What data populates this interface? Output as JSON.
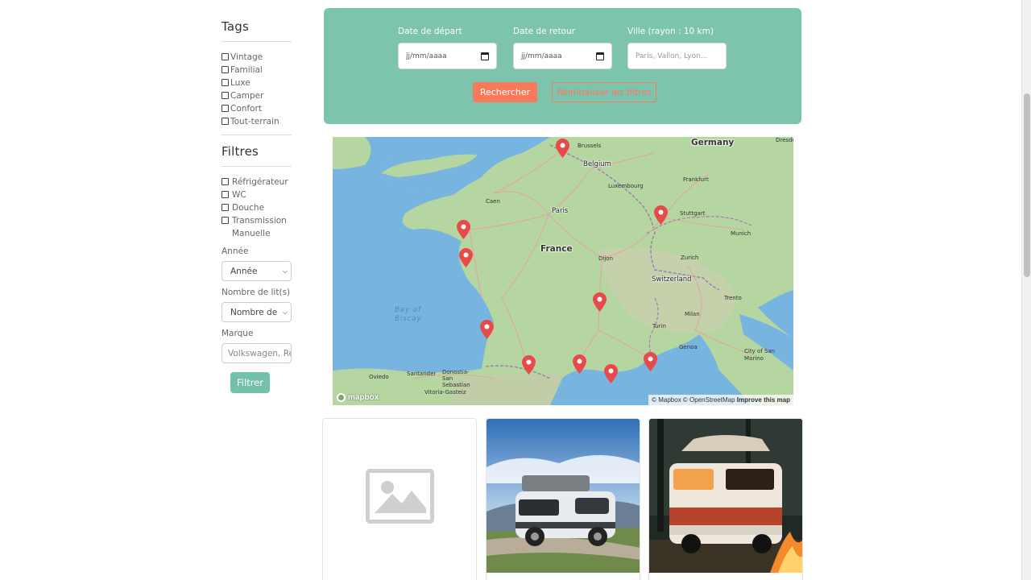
{
  "sidebar": {
    "tags_title": "Tags",
    "tags": [
      "Vintage",
      "Familial",
      "Luxe",
      "Camper",
      "Confort",
      "Tout-terrain"
    ],
    "filters_title": "Filtres",
    "filters": [
      "Réfrigérateur",
      "WC",
      "Douche",
      "Transmission Manuelle"
    ],
    "year_label": "Année",
    "year_selected": "Année",
    "beds_label": "Nombre de lit(s)",
    "beds_selected": "Nombre de",
    "brand_label": "Marque",
    "brand_placeholder": "Volkswagen, Re",
    "filter_button": "Filtrer"
  },
  "search": {
    "departure_label": "Date de départ",
    "departure_value": "jj/mm/aaaa",
    "return_label": "Date de retour",
    "return_value": "jj/mm/aaaa",
    "city_label": "Ville (rayon : 10 km)",
    "city_placeholder": "Paris, Vallon, Lyon...",
    "search_button": "Rechercher",
    "reset_button": "Réinitialiser les filtres"
  },
  "map": {
    "labels": {
      "germany": "Germany",
      "brussels": "Brussels",
      "belgium": "Belgium",
      "dresden": "Dresde",
      "luxembourg": "Luxembourg",
      "frankfurt": "Frankfurt",
      "caen": "Caen",
      "paris": "Paris",
      "stuttgart": "Stuttgart",
      "munich": "Munich",
      "france": "France",
      "dijon": "Dijon",
      "zurich": "Zurich",
      "switzerland": "Switzerland",
      "bay_of_biscay": "Bay of Biscay",
      "trento": "Trento",
      "turin": "Turin",
      "milan": "Milan",
      "genoa": "Genoa",
      "city_of_san_marino": "City of San Marino",
      "oviedo": "Oviedo",
      "santander": "Santander",
      "donostia": "Donostia-San Sebastian",
      "vitoria": "Vitoria-Gasteiz"
    },
    "logo": "mapbox",
    "attribution_mapbox": "© Mapbox",
    "attribution_osm": "© OpenStreetMap",
    "attribution_improve": "Improve this map",
    "marker_color": "#e84a4a"
  },
  "colors": {
    "accent_green": "#7cc4ad",
    "accent_orange": "#f97a5b"
  }
}
